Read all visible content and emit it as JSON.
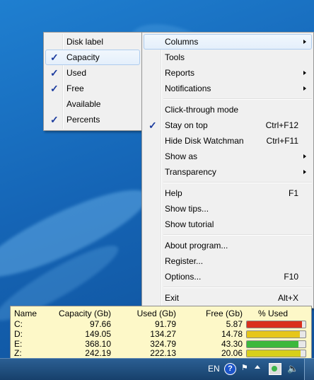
{
  "submenu": {
    "items": [
      {
        "label": "Disk label",
        "checked": false
      },
      {
        "label": "Capacity",
        "checked": true,
        "highlighted": true
      },
      {
        "label": "Used",
        "checked": true
      },
      {
        "label": "Free",
        "checked": true
      },
      {
        "label": "Available",
        "checked": false
      },
      {
        "label": "Percents",
        "checked": true
      }
    ]
  },
  "main_menu": {
    "columns": "Columns",
    "tools": "Tools",
    "reports": "Reports",
    "notifications": "Notifications",
    "click_through": "Click-through mode",
    "stay_on_top": "Stay on top",
    "stay_on_top_shortcut": "Ctrl+F12",
    "hide": "Hide Disk Watchman",
    "hide_shortcut": "Ctrl+F11",
    "show_as": "Show as",
    "transparency": "Transparency",
    "help": "Help",
    "help_shortcut": "F1",
    "show_tips": "Show tips...",
    "show_tutorial": "Show tutorial",
    "about": "About program...",
    "register": "Register...",
    "options": "Options...",
    "options_shortcut": "F10",
    "exit": "Exit",
    "exit_shortcut": "Alt+X",
    "check_glyph": "✓"
  },
  "panel": {
    "headers": {
      "name": "Name",
      "capacity": "Capacity (Gb)",
      "used": "Used (Gb)",
      "free": "Free (Gb)",
      "percent": "% Used"
    },
    "rows": [
      {
        "name": "C:",
        "capacity": "97.66",
        "used": "91.79",
        "free": "5.87",
        "fill": 0.94,
        "color": "#d9301c"
      },
      {
        "name": "D:",
        "capacity": "149.05",
        "used": "134.27",
        "free": "14.78",
        "fill": 0.9,
        "color": "#e6c619"
      },
      {
        "name": "E:",
        "capacity": "368.10",
        "used": "324.79",
        "free": "43.30",
        "fill": 0.88,
        "color": "#3cb83c"
      },
      {
        "name": "Z:",
        "capacity": "242.19",
        "used": "222.13",
        "free": "20.06",
        "fill": 0.92,
        "color": "#d8cf1a"
      }
    ]
  },
  "taskbar": {
    "language": "EN",
    "help_glyph": "?"
  }
}
